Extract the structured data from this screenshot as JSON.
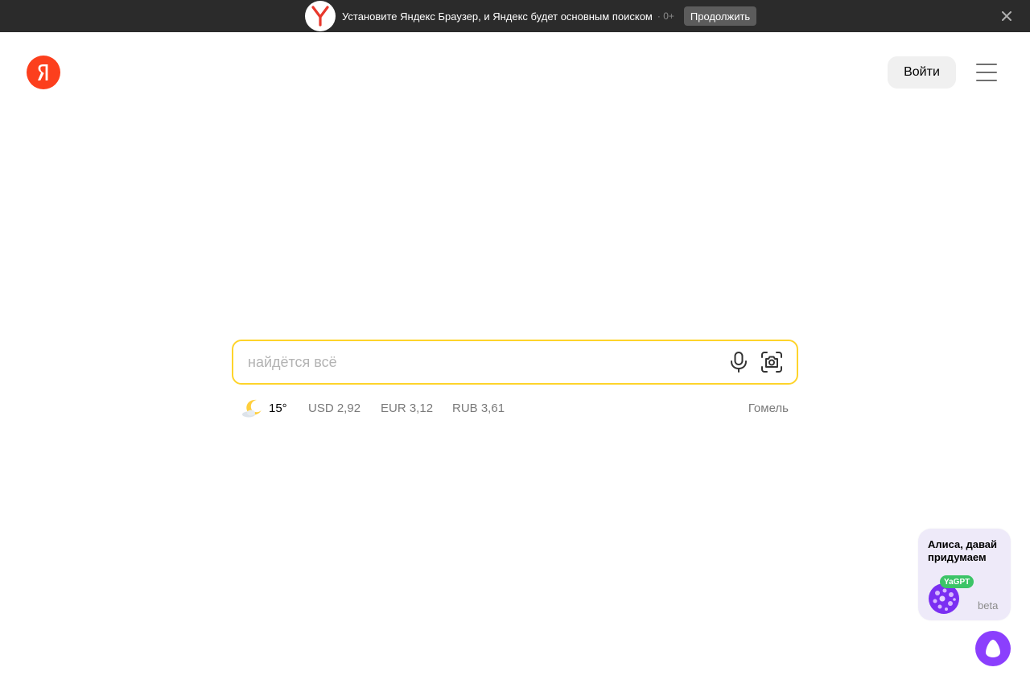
{
  "promo_banner": {
    "text": "Установите Яндекс Браузер, и Яндекс будет основным поиском",
    "age_rating": "· 0+",
    "continue_label": "Продолжить",
    "logo_icon": "yandex-browser-logo-icon",
    "close_icon": "close-icon"
  },
  "header": {
    "logo_letter": "Я",
    "login_label": "Войти",
    "menu_icon": "hamburger-menu-icon"
  },
  "search": {
    "placeholder": "найдётся всё",
    "value": "",
    "mic_icon": "microphone-icon",
    "camera_icon": "camera-search-icon",
    "border_color": "#fed42b"
  },
  "informers": {
    "weather": {
      "icon": "moon-cloud-icon",
      "temperature": "15°"
    },
    "rates": [
      {
        "label": "USD 2,92"
      },
      {
        "label": "EUR 3,12"
      },
      {
        "label": "RUB 3,61"
      }
    ],
    "city": "Гомель"
  },
  "alice_promo": {
    "title": "Алиса, давай придумаем",
    "badge": "YaGPT",
    "beta": "beta",
    "alice_button_icon": "alice-icon"
  },
  "colors": {
    "banner_bg": "#2b2b2b",
    "logo_red": "#fc3f1d",
    "alice_purple": "#8b3ffd",
    "yagpt_green": "#3cc467"
  }
}
